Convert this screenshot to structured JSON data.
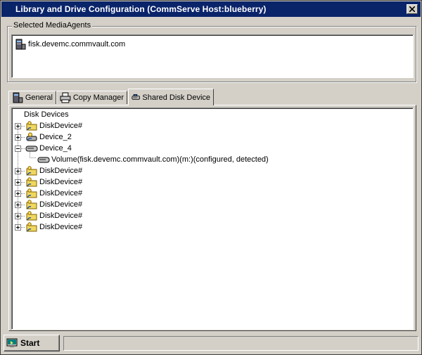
{
  "window": {
    "title": "Library and Drive Configuration (CommServe Host:blueberry)"
  },
  "media_agents": {
    "legend": "Selected MediaAgents",
    "items": [
      {
        "label": "fisk.devemc.commvault.com",
        "icon": "server-icon"
      }
    ]
  },
  "tabs": [
    {
      "label": "General",
      "icon": "server-icon",
      "active": false
    },
    {
      "label": "Copy Manager",
      "icon": "printer-icon",
      "active": false
    },
    {
      "label": "Shared Disk Device",
      "icon": "disk-device-icon",
      "active": true
    }
  ],
  "tree": {
    "root_label": "Disk Devices",
    "nodes": [
      {
        "label": "DiskDevice#",
        "icon": "shared-folder-icon",
        "expander": "+"
      },
      {
        "label": "Device_2",
        "icon": "shared-disk-icon",
        "expander": "+"
      },
      {
        "label": "Device_4",
        "icon": "disk-device-icon",
        "expander": "-",
        "children": [
          {
            "label": "Volume(fisk.devemc.commvault.com)(m:)(configured, detected)",
            "icon": "disk-device-icon"
          }
        ]
      },
      {
        "label": "DiskDevice#",
        "icon": "shared-folder-icon",
        "expander": "+"
      },
      {
        "label": "DiskDevice#",
        "icon": "shared-folder-icon",
        "expander": "+"
      },
      {
        "label": "DiskDevice#",
        "icon": "shared-folder-icon",
        "expander": "+"
      },
      {
        "label": "DiskDevice#",
        "icon": "shared-folder-icon",
        "expander": "+"
      },
      {
        "label": "DiskDevice#",
        "icon": "shared-folder-icon",
        "expander": "+"
      },
      {
        "label": "DiskDevice#",
        "icon": "shared-folder-icon",
        "expander": "+"
      }
    ]
  },
  "statusbar": {
    "start_label": "Start",
    "status_text": ""
  },
  "colors": {
    "titlebar": "#0a246a",
    "face": "#d4d0c8"
  }
}
